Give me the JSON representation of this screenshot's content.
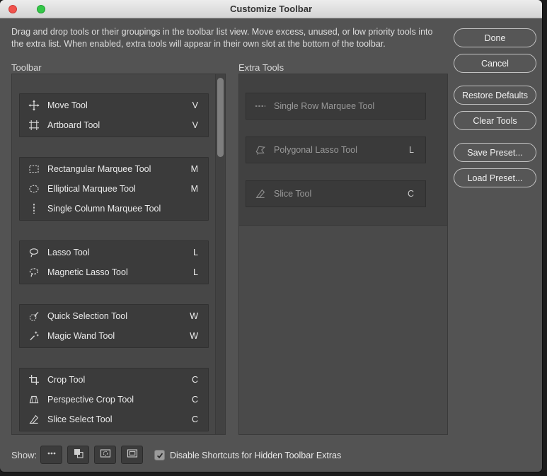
{
  "window": {
    "title": "Customize Toolbar"
  },
  "description": {
    "line1": "Drag and drop tools or their groupings in the toolbar list view. Move excess, unused, or low priority tools into",
    "line2": "the extra list. When enabled, extra tools will appear in their own slot at the bottom of the toolbar."
  },
  "action_buttons": {
    "done": "Done",
    "cancel": "Cancel",
    "restore_defaults": "Restore Defaults",
    "clear_tools": "Clear Tools",
    "save_preset": "Save Preset...",
    "load_preset": "Load Preset..."
  },
  "toolbar_panel": {
    "label": "Toolbar",
    "groups": [
      {
        "tools": [
          {
            "icon": "move-tool-icon",
            "name": "Move Tool",
            "shortcut": "V"
          },
          {
            "icon": "artboard-tool-icon",
            "name": "Artboard Tool",
            "shortcut": "V"
          }
        ]
      },
      {
        "tools": [
          {
            "icon": "rect-marquee-icon",
            "name": "Rectangular Marquee Tool",
            "shortcut": "M"
          },
          {
            "icon": "ellip-marquee-icon",
            "name": "Elliptical Marquee Tool",
            "shortcut": "M"
          },
          {
            "icon": "single-col-marquee-icon",
            "name": "Single Column Marquee Tool",
            "shortcut": ""
          }
        ]
      },
      {
        "tools": [
          {
            "icon": "lasso-icon",
            "name": "Lasso Tool",
            "shortcut": "L"
          },
          {
            "icon": "magnetic-lasso-icon",
            "name": "Magnetic Lasso Tool",
            "shortcut": "L"
          }
        ]
      },
      {
        "tools": [
          {
            "icon": "quick-selection-icon",
            "name": "Quick Selection Tool",
            "shortcut": "W"
          },
          {
            "icon": "magic-wand-icon",
            "name": "Magic Wand Tool",
            "shortcut": "W"
          }
        ]
      },
      {
        "tools": [
          {
            "icon": "crop-tool-icon",
            "name": "Crop Tool",
            "shortcut": "C"
          },
          {
            "icon": "perspective-crop-icon",
            "name": "Perspective Crop Tool",
            "shortcut": "C"
          },
          {
            "icon": "slice-select-icon",
            "name": "Slice Select Tool",
            "shortcut": "C"
          }
        ]
      }
    ]
  },
  "extra_panel": {
    "label": "Extra Tools",
    "items": [
      {
        "icon": "single-row-marquee-icon",
        "name": "Single Row Marquee Tool",
        "shortcut": ""
      },
      {
        "icon": "polygonal-lasso-icon",
        "name": "Polygonal Lasso Tool",
        "shortcut": "L"
      },
      {
        "icon": "slice-tool-icon",
        "name": "Slice Tool",
        "shortcut": "C"
      }
    ]
  },
  "footer": {
    "show_label": "Show:",
    "show_buttons": [
      {
        "icon": "ellipsis-icon"
      },
      {
        "icon": "fg-bg-colors-icon"
      },
      {
        "icon": "quick-mask-icon"
      },
      {
        "icon": "screen-mode-icon"
      }
    ],
    "checkbox": {
      "checked": true,
      "label": "Disable Shortcuts for Hidden Toolbar Extras"
    }
  },
  "colors": {
    "dialog_bg": "#535353",
    "panel_bg": "#474747",
    "group_bg": "#3b3b3b",
    "titlebar_bg": "#e0e0e0",
    "text_light": "#ebebeb",
    "text_dim": "#999999",
    "traffic_red": "#f0524c",
    "traffic_green": "#34c748"
  }
}
